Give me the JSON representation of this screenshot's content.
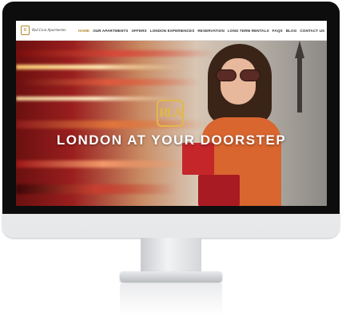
{
  "logo": {
    "mark": "R",
    "text": "Red Lion Apartments"
  },
  "nav": {
    "items": [
      {
        "label": "HOME",
        "active": true
      },
      {
        "label": "OUR APARTMENTS",
        "active": false
      },
      {
        "label": "OFFERS",
        "active": false
      },
      {
        "label": "LONDON EXPERIENCES",
        "active": false
      },
      {
        "label": "RESERVATION",
        "active": false
      },
      {
        "label": "LONG TERM RENTALS",
        "active": false
      },
      {
        "label": "FAQS",
        "active": false
      },
      {
        "label": "BLOG",
        "active": false
      },
      {
        "label": "CONTACT US",
        "active": false
      }
    ]
  },
  "hero": {
    "logo_mark": "RLA",
    "title": "LONDON AT YOUR DOORSTEP"
  },
  "colors": {
    "accent": "#b08a2e",
    "hero_logo": "#e0b84a",
    "title": "#ffffff"
  }
}
